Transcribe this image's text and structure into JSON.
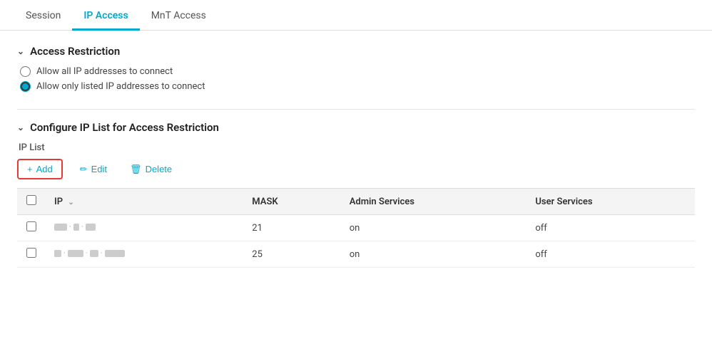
{
  "tabs": [
    {
      "id": "session",
      "label": "Session",
      "active": false
    },
    {
      "id": "ip-access",
      "label": "IP Access",
      "active": true
    },
    {
      "id": "mnt-access",
      "label": "MnT Access",
      "active": false
    }
  ],
  "access_restriction": {
    "section_title": "Access Restriction",
    "options": [
      {
        "id": "allow-all",
        "label": "Allow all IP addresses to connect",
        "checked": false
      },
      {
        "id": "allow-listed",
        "label": "Allow only listed IP addresses to connect",
        "checked": true
      }
    ]
  },
  "ip_list_section": {
    "section_title": "Configure IP List for Access Restriction",
    "ip_list_label": "IP List",
    "toolbar": {
      "add_label": "+ Add",
      "edit_label": "Edit",
      "delete_label": "Delete"
    },
    "table": {
      "columns": [
        {
          "id": "checkbox",
          "label": "",
          "sortable": false
        },
        {
          "id": "ip",
          "label": "IP",
          "sortable": true
        },
        {
          "id": "mask",
          "label": "MASK",
          "sortable": false
        },
        {
          "id": "admin_services",
          "label": "Admin Services",
          "sortable": false
        },
        {
          "id": "user_services",
          "label": "User Services",
          "sortable": false
        }
      ],
      "rows": [
        {
          "id": "row1",
          "ip_display": "redacted1",
          "mask": "21",
          "admin_services": "on",
          "user_services": "off"
        },
        {
          "id": "row2",
          "ip_display": "redacted2",
          "mask": "25",
          "admin_services": "on",
          "user_services": "off"
        }
      ]
    }
  }
}
